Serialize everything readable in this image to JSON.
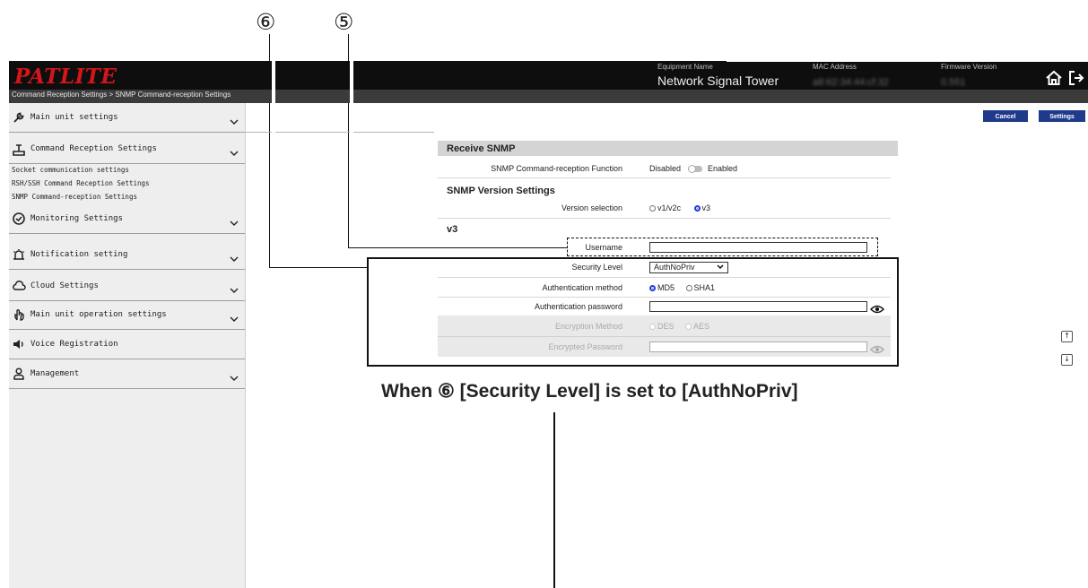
{
  "callouts": {
    "c6": "⑥",
    "c5": "⑤"
  },
  "header": {
    "logo": "PATLITE",
    "breadcrumb": "Command Reception Settings > SNMP Command-reception Settings",
    "equipment_name_label": "Equipment Name",
    "equipment_name": "Network Signal Tower",
    "mac_label": "MAC Address",
    "mac_value": "a8:62:34:44:cf:32",
    "firmware_label": "Firmware Version",
    "firmware_value": "0.551"
  },
  "sidebar": {
    "items": [
      {
        "label": "Main unit settings",
        "icon": "wrench-icon"
      },
      {
        "label": "Command Reception Settings",
        "icon": "antenna-icon"
      },
      {
        "label": "Monitoring Settings",
        "icon": "gauge-icon"
      },
      {
        "label": "Notification setting",
        "icon": "alarm-icon"
      },
      {
        "label": "Cloud Settings",
        "icon": "cloud-icon"
      },
      {
        "label": "Main unit operation settings",
        "icon": "hand-icon"
      },
      {
        "label": "Voice Registration",
        "icon": "speaker-icon"
      },
      {
        "label": "Management",
        "icon": "user-icon"
      }
    ],
    "sub_items": [
      "Socket communication settings",
      "RSH/SSH Command Reception Settings",
      "SNMP Command-reception Settings"
    ]
  },
  "toolbar": {
    "cancel": "Cancel",
    "settings": "Settings"
  },
  "form": {
    "section_title": "Receive SNMP",
    "function_label": "SNMP Command-reception Function",
    "disabled": "Disabled",
    "enabled": "Enabled",
    "version_heading": "SNMP Version Settings",
    "version_label": "Version selection",
    "v1": "v1/v2c",
    "v3": "v3",
    "v3_heading": "v3",
    "username_label": "Username",
    "username_value": "",
    "security_label": "Security Level",
    "security_value": "AuthNoPriv",
    "auth_method_label": "Authentication method",
    "md5": "MD5",
    "sha1": "SHA1",
    "auth_password_label": "Authentication password",
    "enc_method_label": "Encryption Method",
    "des": "DES",
    "aes": "AES",
    "enc_password_label": "Encrypted Password"
  },
  "annotation": "When ⑥ [Security Level] is set to [AuthNoPriv]",
  "colors": {
    "brand": "#d4161c",
    "button": "#1f3a8a",
    "radio": "#1f3ed6"
  }
}
